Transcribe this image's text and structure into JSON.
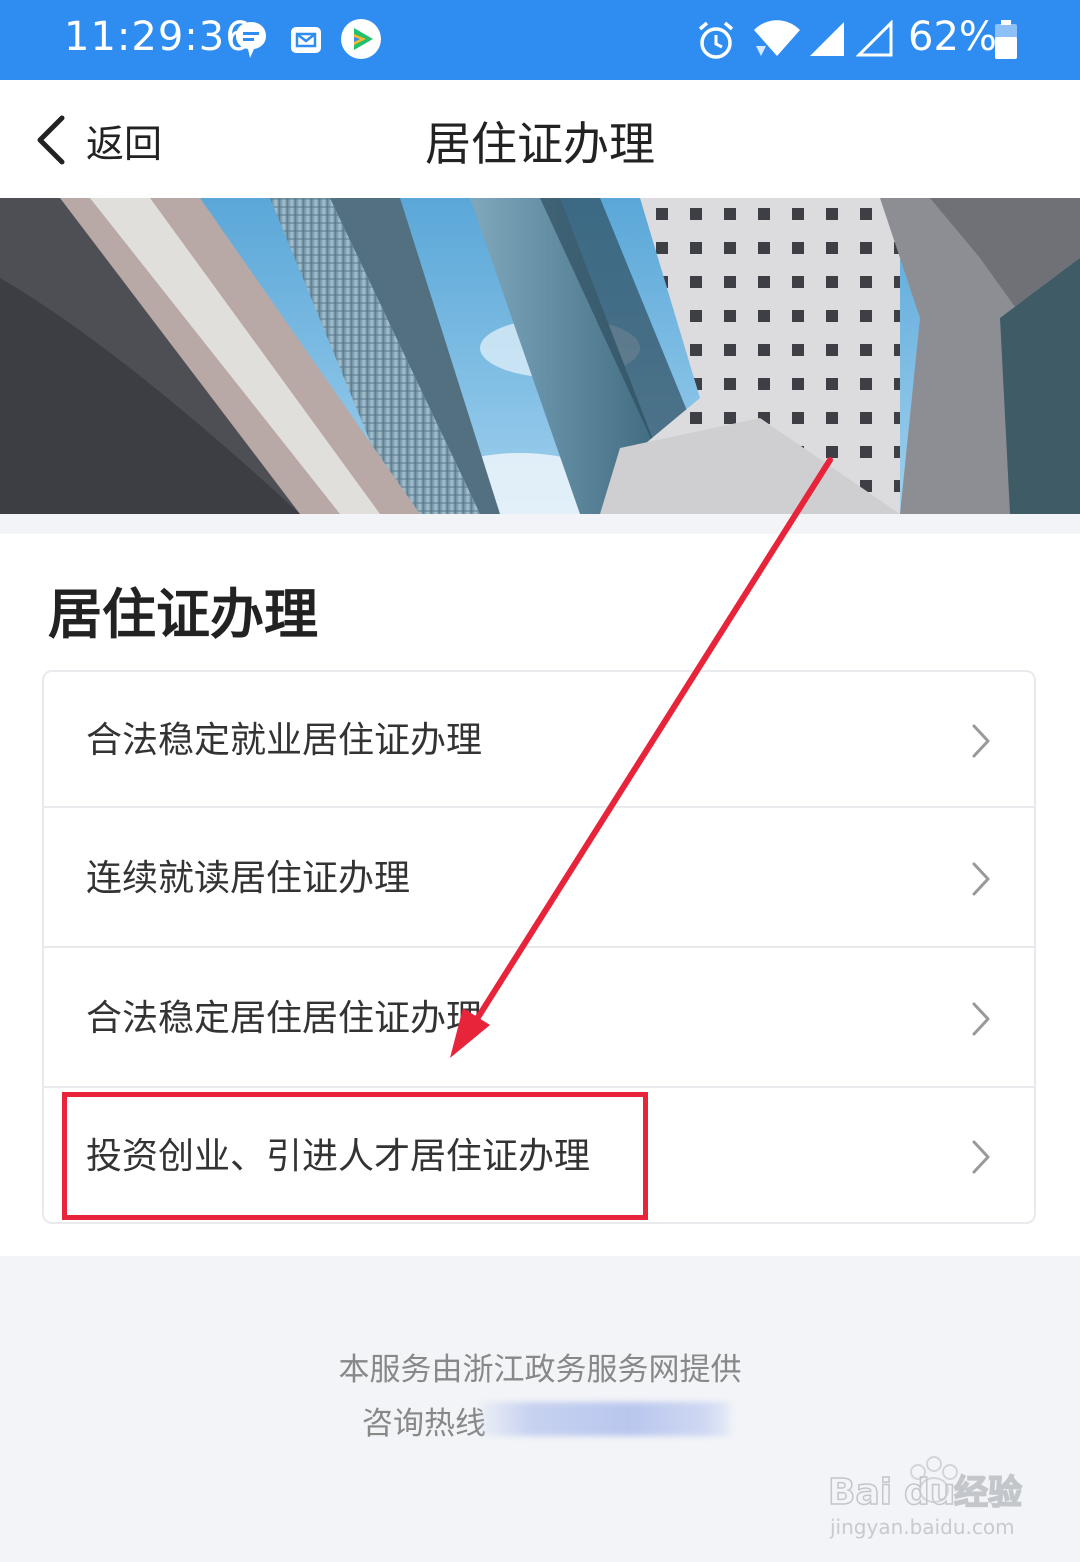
{
  "status_bar": {
    "time": "11:29:36",
    "battery": "62%",
    "icons": [
      "chat-icon",
      "mail-icon",
      "video-app-icon",
      "alarm-icon",
      "wifi-icon",
      "signal-icon",
      "signal-empty-icon",
      "battery-icon"
    ]
  },
  "nav": {
    "back_label": "返回",
    "title": "居住证办理"
  },
  "section": {
    "title": "居住证办理"
  },
  "list": {
    "items": [
      {
        "label": "合法稳定就业居住证办理"
      },
      {
        "label": "连续就读居住证办理"
      },
      {
        "label": "合法稳定居住居住证办理"
      },
      {
        "label": "投资创业、引进人才居住证办理"
      }
    ]
  },
  "footer": {
    "provider": "本服务由浙江政务服务网提供",
    "hotline_label": "咨询热线"
  },
  "watermark": {
    "brand": "Baidu经验",
    "url": "jingyan.baidu.com"
  },
  "colors": {
    "status_bar": "#2f8cf0",
    "annotation_red": "#e8243b",
    "page_bg": "#f2f4f7"
  }
}
